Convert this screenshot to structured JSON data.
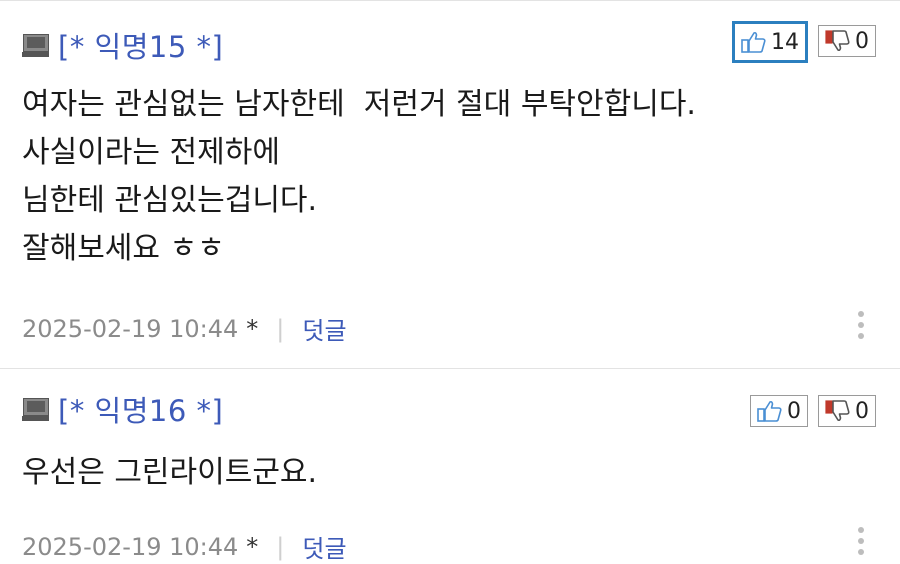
{
  "comments": [
    {
      "author": "[* 익명15 *]",
      "likes": "14",
      "dislikes": "0",
      "lines": [
        "여자는 관심없는 남자한테  저런거 절대 부탁안합니다.",
        "사실이라는 전제하에",
        "님한테 관심있는겁니다.",
        "잘해보세요 ㅎㅎ"
      ],
      "timestamp": "2025-02-19 10:44",
      "star": "*",
      "separator": "|",
      "reply_label": "덧글"
    },
    {
      "author": "[* 익명16 *]",
      "likes": "0",
      "dislikes": "0",
      "lines": [
        "우선은 그린라이트군요."
      ],
      "timestamp": "2025-02-19 10:44",
      "star": "*",
      "separator": "|",
      "reply_label": "덧글"
    }
  ],
  "icons": {
    "author_icon": "pc-monitor-icon",
    "like_icon": "thumbs-up-icon",
    "dislike_icon": "thumbs-down-icon",
    "more_icon": "more-vertical-icon"
  },
  "colors": {
    "author": "#3d5ab8",
    "reply_link": "#3d5ab8",
    "active_vote_border": "#2b7fbf",
    "like_icon": "#4a8fd4",
    "dislike_icon": "#c0392b"
  }
}
